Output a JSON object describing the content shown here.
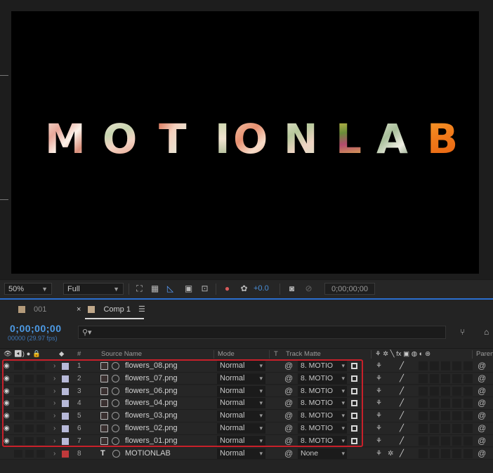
{
  "canvas": {
    "letters": [
      "M",
      "O",
      "T",
      "I",
      "O",
      "N",
      "L",
      "A",
      "B"
    ]
  },
  "viewer_toolbar": {
    "zoom": "50%",
    "resolution": "Full",
    "exposure": "+0.0",
    "timecode": "0;00;00;00"
  },
  "tabs": [
    {
      "label": "001",
      "color": "#b39a7a"
    },
    {
      "label": "Comp 1",
      "close": "×",
      "color": "#c0a88a"
    }
  ],
  "timeline": {
    "current_time": "0;00;00;00",
    "frame_info": "00000 (29.97 fps)",
    "search_placeholder": "",
    "search_glyph": "⚲▾"
  },
  "columns": {
    "number": "#",
    "source_name": "Source Name",
    "mode": "Mode",
    "t": "T",
    "track_matte": "Track Matte",
    "parent": "Paren"
  },
  "layers": [
    {
      "num": "1",
      "name": "flowers_08.png",
      "mode": "Normal",
      "matte": "8. MOTIO",
      "label_color": "#b7b9d8",
      "type": "image"
    },
    {
      "num": "2",
      "name": "flowers_07.png",
      "mode": "Normal",
      "matte": "8. MOTIO",
      "label_color": "#b7b9d8",
      "type": "image"
    },
    {
      "num": "3",
      "name": "flowers_06.png",
      "mode": "Normal",
      "matte": "8. MOTIO",
      "label_color": "#b7b9d8",
      "type": "image"
    },
    {
      "num": "4",
      "name": "flowers_04.png",
      "mode": "Normal",
      "matte": "8. MOTIO",
      "label_color": "#b7b9d8",
      "type": "image"
    },
    {
      "num": "5",
      "name": "flowers_03.png",
      "mode": "Normal",
      "matte": "8. MOTIO",
      "label_color": "#b7b9d8",
      "type": "image"
    },
    {
      "num": "6",
      "name": "flowers_02.png",
      "mode": "Normal",
      "matte": "8. MOTIO",
      "label_color": "#b7b9d8",
      "type": "image"
    },
    {
      "num": "7",
      "name": "flowers_01.png",
      "mode": "Normal",
      "matte": "8. MOTIO",
      "label_color": "#b7b9d8",
      "type": "image"
    },
    {
      "num": "8",
      "name": "MOTIONLAB",
      "mode": "Normal",
      "matte": "None",
      "label_color": "#c0393b",
      "type": "text"
    }
  ],
  "colors": {
    "accent_blue": "#2b6fd0",
    "highlight_red": "#c8202a",
    "orange_letter": "#f07a1a"
  }
}
